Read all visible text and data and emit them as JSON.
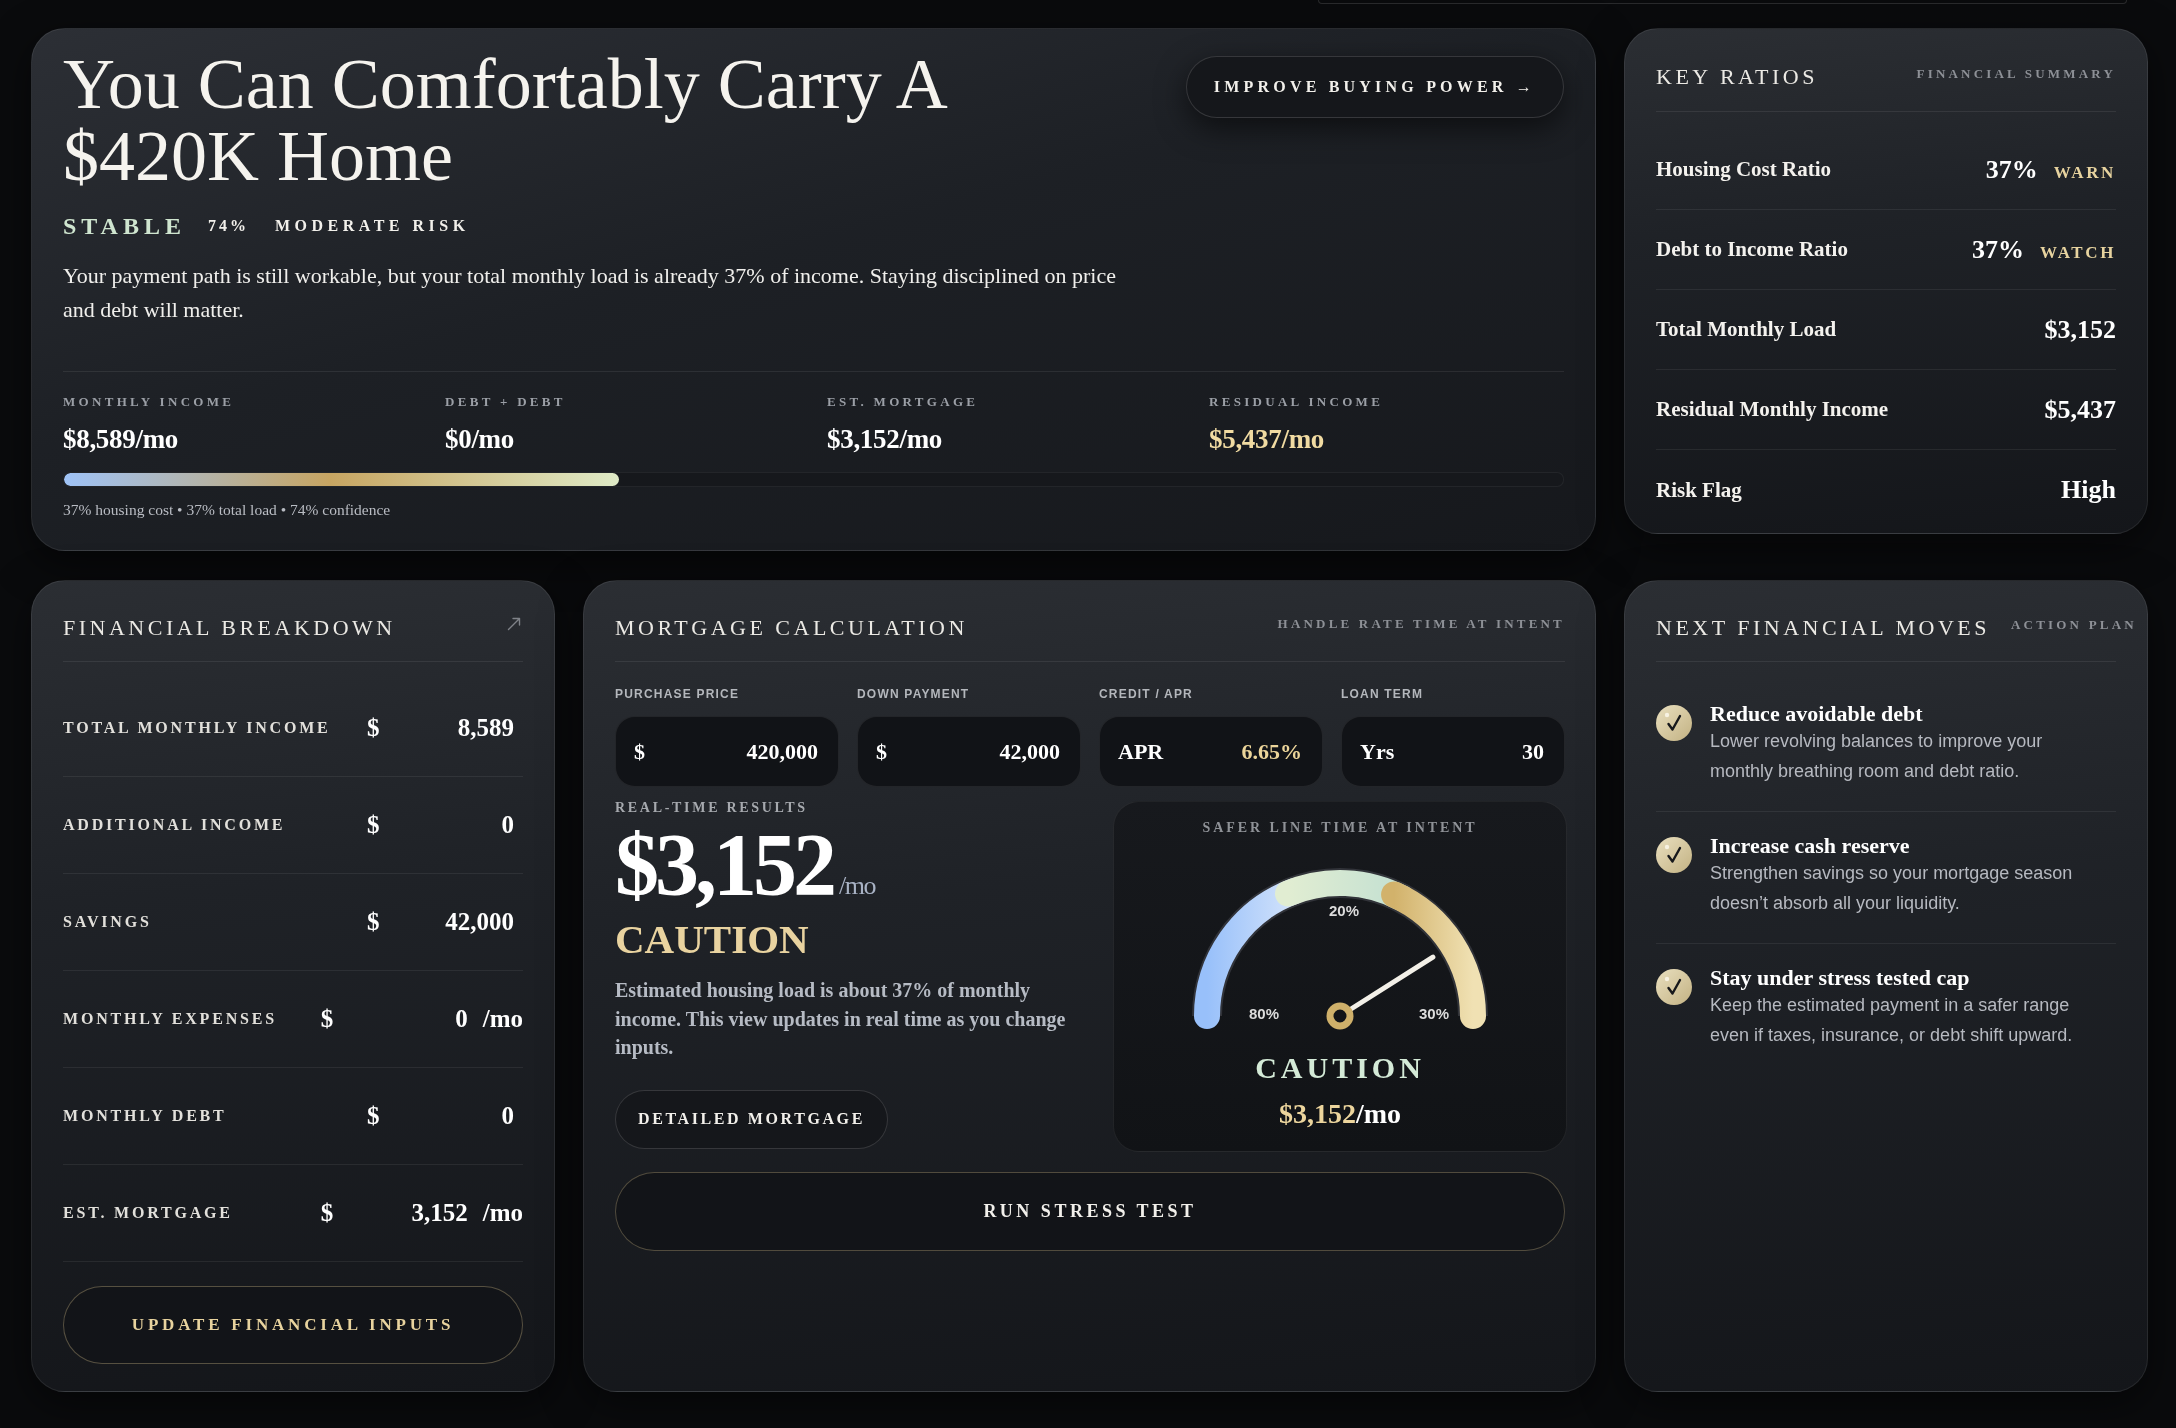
{
  "hero": {
    "title": "You Can Comfortably Carry A $420K Home",
    "action_button": "IMPROVE BUYING POWER →",
    "status": "STABLE",
    "confidence": "74%",
    "risk": "MODERATE RISK",
    "summary": "Your payment path is still workable, but your total monthly load is already 37% of income. Staying disciplined on price and debt will matter.",
    "stats": [
      {
        "label": "MONTHLY INCOME",
        "value": "$8,589/mo",
        "highlighted": false
      },
      {
        "label": "DEBT + DEBT",
        "value": "$0/mo",
        "highlighted": false
      },
      {
        "label": "EST. MORTGAGE",
        "value": "$3,152/mo",
        "highlighted": false
      },
      {
        "label": "RESIDUAL INCOME",
        "value": "$5,437/mo",
        "highlighted": true
      }
    ],
    "progress": {
      "level": 0.37
    },
    "caption": "37% housing cost • 37% total load • 74% confidence"
  },
  "key_ratios": {
    "title": "KEY RATIOS",
    "subtitle": "FINANCIAL SUMMARY",
    "rows": [
      {
        "label": "Housing Cost Ratio",
        "value": "37%",
        "flag": "WARN"
      },
      {
        "label": "Debt to Income Ratio",
        "value": "37%",
        "flag": "WATCH"
      },
      {
        "label": "Total Monthly Load",
        "value": "$3,152"
      },
      {
        "label": "Residual Monthly Income",
        "value": "$5,437"
      },
      {
        "label": "Risk Flag",
        "value": "High"
      }
    ]
  },
  "financial_breakdown": {
    "title": "FINANCIAL BREAKDOWN",
    "rows": [
      {
        "label": "TOTAL MONTHLY INCOME",
        "currency": "$",
        "value": "8,589"
      },
      {
        "label": "ADDITIONAL INCOME",
        "currency": "$",
        "value": "0"
      },
      {
        "label": "SAVINGS",
        "currency": "$",
        "value": "42,000"
      },
      {
        "label": "MONTHLY EXPENSES",
        "currency": "$",
        "value": "0",
        "suffix": "/mo"
      },
      {
        "label": "MONTHLY DEBT",
        "currency": "$",
        "value": "0"
      },
      {
        "label": "EST. MORTGAGE",
        "currency": "$",
        "value": "3,152",
        "suffix": "/mo"
      }
    ],
    "button": "UPDATE FINANCIAL INPUTS"
  },
  "mortgage_calculation": {
    "title": "MORTGAGE CALCULATION",
    "subtitle": "HANDLE RATE TIME AT INTENT",
    "inputs": [
      {
        "label": "PURCHASE PRICE",
        "prefix": "$",
        "value": "420,000",
        "highlighted": false
      },
      {
        "label": "DOWN PAYMENT",
        "prefix": "$",
        "value": "42,000",
        "highlighted": false
      },
      {
        "label": "CREDIT / APR",
        "prefix": "APR",
        "value": "6.65%",
        "highlighted": true
      },
      {
        "label": "LOAN TERM",
        "prefix": "Yrs",
        "value": "30",
        "highlighted": false
      }
    ],
    "results_label": "REAL-TIME RESULTS",
    "payment": "$3,152",
    "payment_unit": "/mo",
    "status": "CAUTION",
    "note": "Estimated housing load is about 37% of monthly income. This view updates in real time as you change inputs.",
    "detail_button": "DETAILED MORTGAGE",
    "gauge": {
      "title": "SAFER LINE TIME AT INTENT",
      "labels": [
        "80%",
        "20%",
        "30%"
      ],
      "status": "CAUTION",
      "amount": "$3,152",
      "unit": "/mo"
    },
    "stress_button": "RUN STRESS TEST"
  },
  "next_moves": {
    "title": "NEXT FINANCIAL MOVES",
    "subtitle": "ACTION PLAN",
    "items": [
      {
        "title": "Reduce avoidable debt",
        "description": "Lower revolving balances to improve your monthly breathing room and debt ratio."
      },
      {
        "title": "Increase cash reserve",
        "description": "Strengthen savings so your mortgage season doesn’t absorb all your liquidity."
      },
      {
        "title": "Stay under stress tested cap",
        "description": "Keep the estimated payment in a safer range even if taxes, insurance, or debt shift upward."
      }
    ]
  }
}
